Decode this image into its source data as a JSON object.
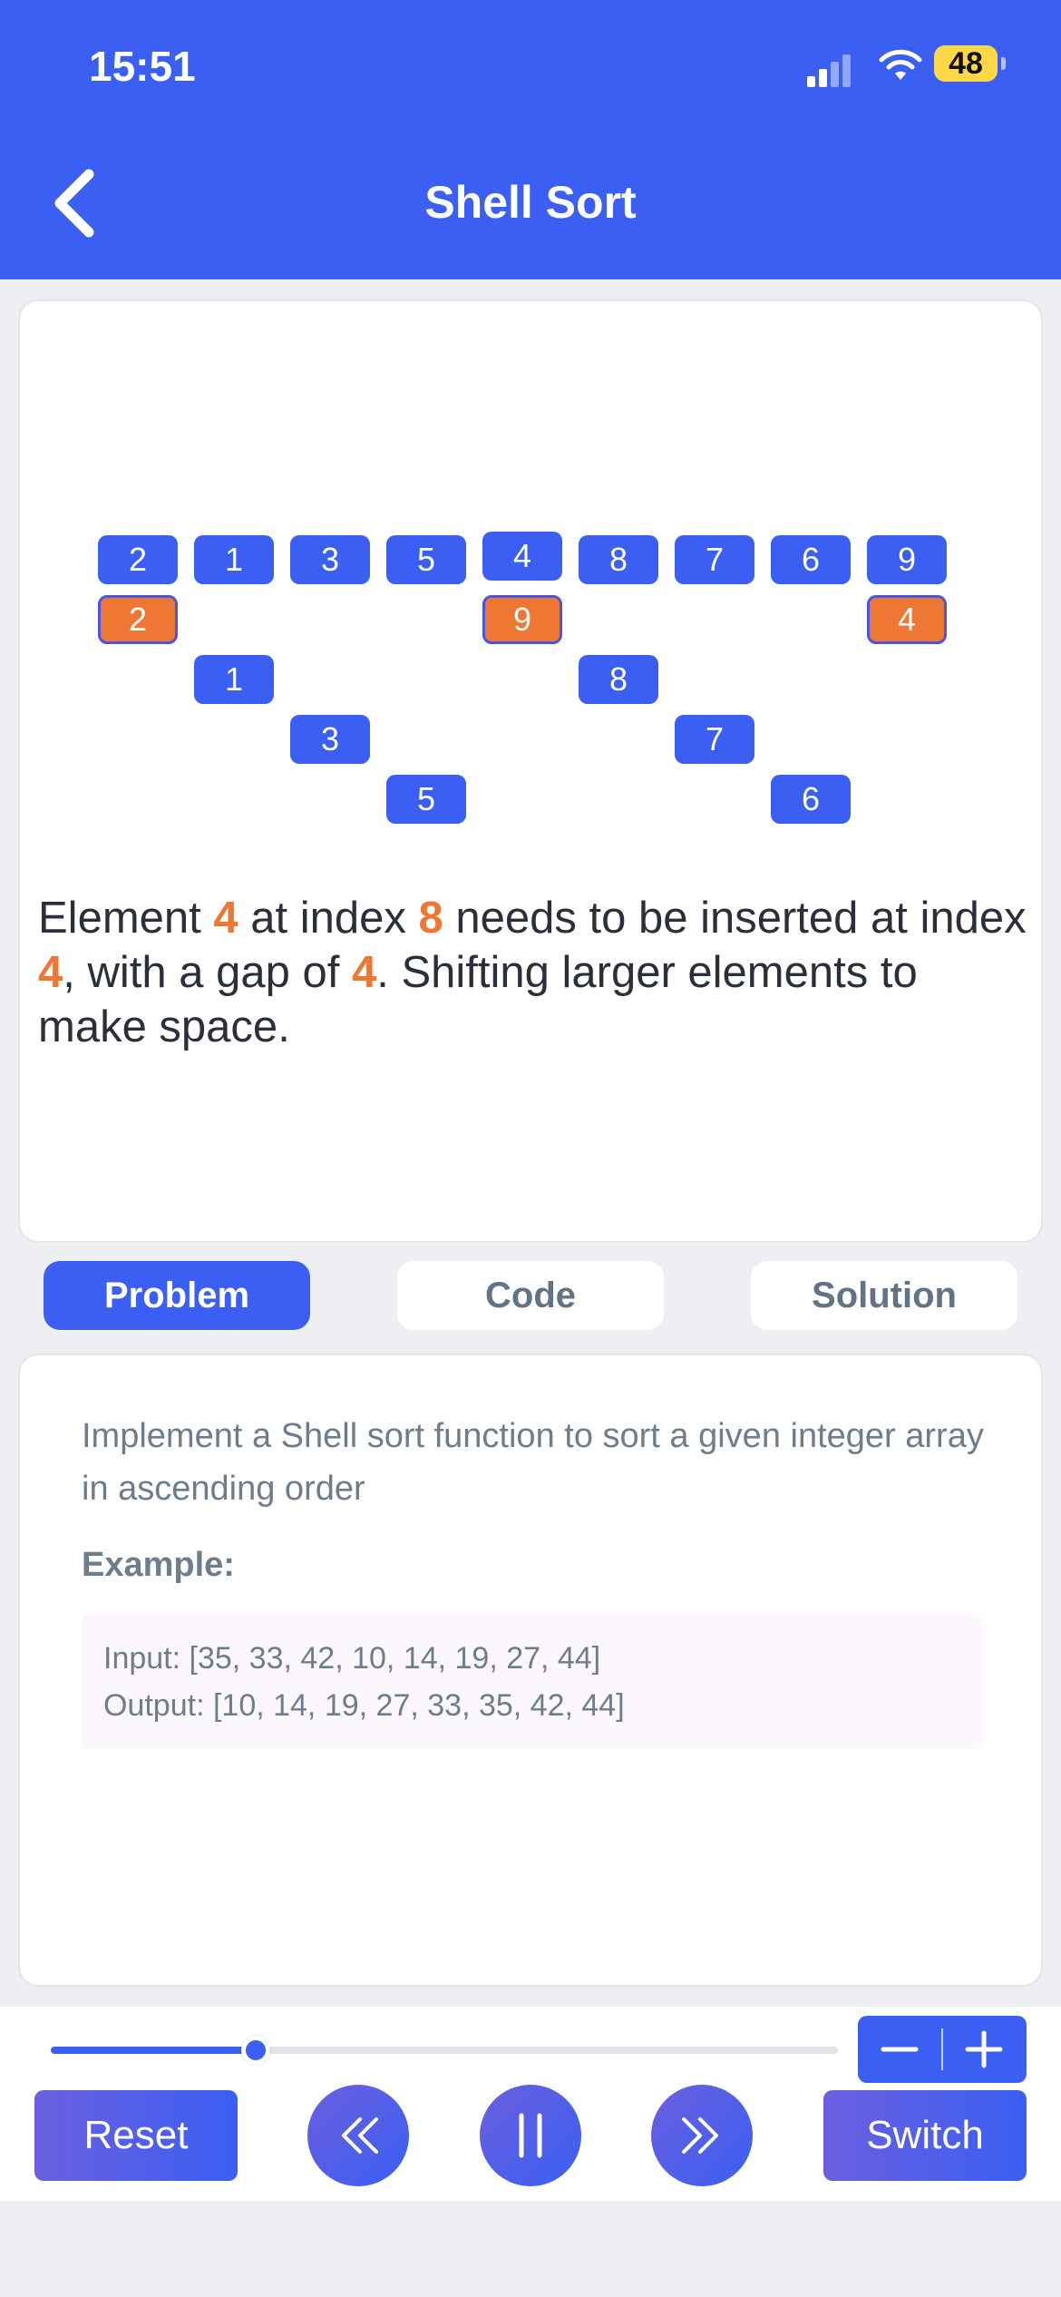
{
  "status_bar": {
    "time": "15:51",
    "battery": "48"
  },
  "header": {
    "title": "Shell Sort",
    "back_icon": "chevron-left-icon"
  },
  "visualization": {
    "array": [
      "2",
      "1",
      "3",
      "5",
      "4",
      "8",
      "7",
      "6",
      "9"
    ],
    "gap_rows": [
      [
        {
          "i": 0,
          "v": "2",
          "hl": true
        },
        {
          "i": 4,
          "v": "9",
          "hl": true
        },
        {
          "i": 8,
          "v": "4",
          "hl": true
        }
      ],
      [
        {
          "i": 1,
          "v": "1"
        },
        {
          "i": 5,
          "v": "8"
        }
      ],
      [
        {
          "i": 2,
          "v": "3"
        },
        {
          "i": 6,
          "v": "7"
        }
      ],
      [
        {
          "i": 3,
          "v": "5"
        },
        {
          "i": 7,
          "v": "6"
        }
      ]
    ],
    "message": {
      "p1": "Element ",
      "element": "4",
      "p2": " at index ",
      "index": "8",
      "p3": " needs to be inserted at index ",
      "target": "4",
      "p4": ", with a gap of ",
      "gap": "4",
      "p5": ". Shifting larger elements to make space."
    },
    "accent_color": "#ee7733",
    "cell_color": "#3a5ff2"
  },
  "tabs": [
    {
      "label": "Problem",
      "active": true
    },
    {
      "label": "Code",
      "active": false
    },
    {
      "label": "Solution",
      "active": false
    }
  ],
  "problem": {
    "description": "Implement a Shell sort function to sort a given integer array in ascending order",
    "example_label": "Example:",
    "input": "Input: [35, 33, 42, 10, 14, 19, 27, 44]",
    "output": "Output: [10, 14, 19, 27, 33, 35, 42, 44]"
  },
  "controls": {
    "progress": 0.26,
    "reset_label": "Reset",
    "switch_label": "Switch",
    "icons": [
      "rewind-icon",
      "pause-icon",
      "fast-forward-icon",
      "minus-icon",
      "plus-icon"
    ]
  }
}
